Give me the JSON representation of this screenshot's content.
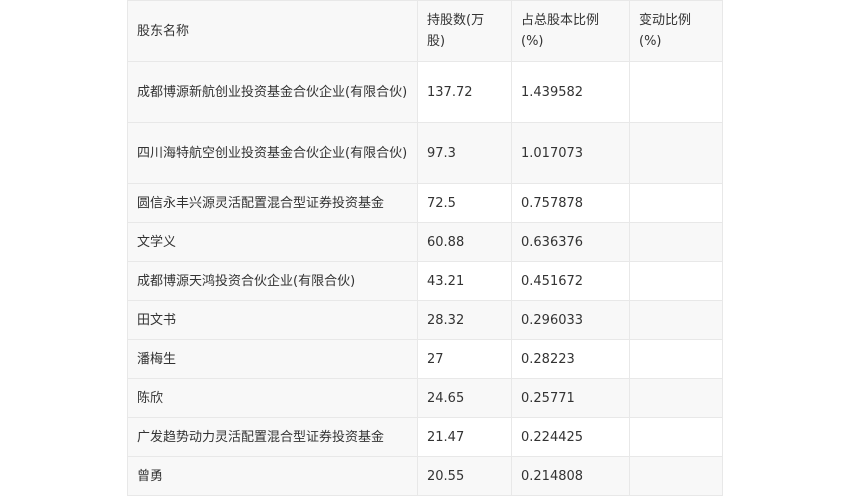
{
  "table": {
    "headers": [
      "股东名称",
      "持股数(万股)",
      "占总股本比例(%)",
      "变动比例(%)"
    ],
    "rows": [
      {
        "name": "成都博源新航创业投资基金合伙企业(有限合伙)",
        "shares": "137.72",
        "ratio": "1.439582",
        "change": ""
      },
      {
        "name": "四川海特航空创业投资基金合伙企业(有限合伙)",
        "shares": "97.3",
        "ratio": "1.017073",
        "change": ""
      },
      {
        "name": "圆信永丰兴源灵活配置混合型证券投资基金",
        "shares": "72.5",
        "ratio": "0.757878",
        "change": ""
      },
      {
        "name": "文学义",
        "shares": "60.88",
        "ratio": "0.636376",
        "change": ""
      },
      {
        "name": "成都博源天鸿投资合伙企业(有限合伙)",
        "shares": "43.21",
        "ratio": "0.451672",
        "change": ""
      },
      {
        "name": "田文书",
        "shares": "28.32",
        "ratio": "0.296033",
        "change": ""
      },
      {
        "name": "潘梅生",
        "shares": "27",
        "ratio": "0.28223",
        "change": ""
      },
      {
        "name": "陈欣",
        "shares": "24.65",
        "ratio": "0.25771",
        "change": ""
      },
      {
        "name": "广发趋势动力灵活配置混合型证券投资基金",
        "shares": "21.47",
        "ratio": "0.224425",
        "change": ""
      },
      {
        "name": "曾勇",
        "shares": "20.55",
        "ratio": "0.214808",
        "change": ""
      }
    ]
  }
}
